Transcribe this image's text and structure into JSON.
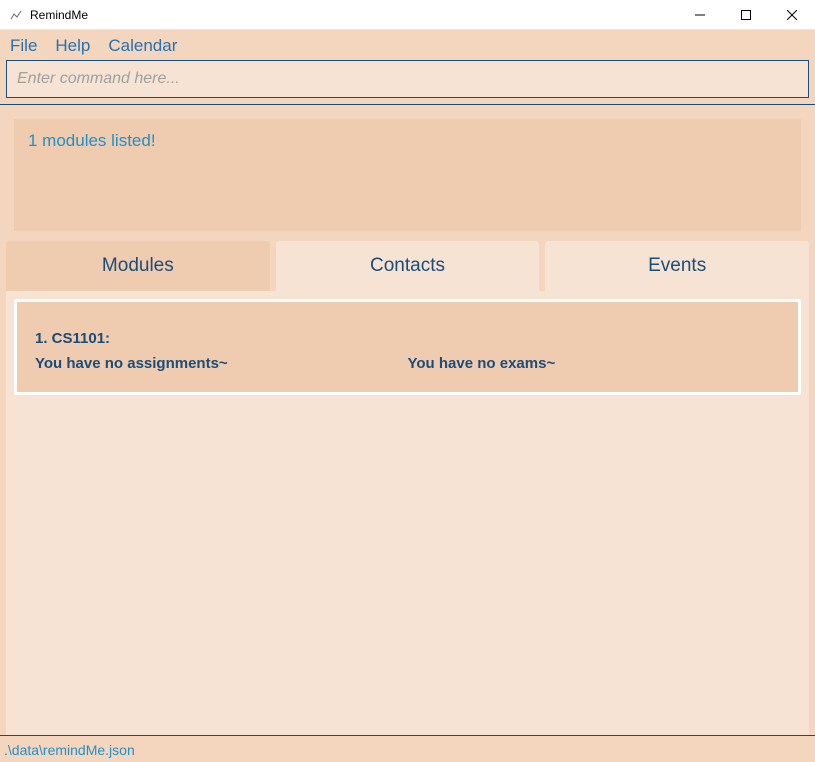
{
  "window": {
    "title": "RemindMe",
    "minimize": "—",
    "maximize": "☐",
    "close": "✕"
  },
  "menubar": {
    "file": "File",
    "help": "Help",
    "calendar": "Calendar"
  },
  "command": {
    "placeholder": "Enter command here..."
  },
  "status": {
    "message": "1 modules listed!"
  },
  "tabs": {
    "modules": "Modules",
    "contacts": "Contacts",
    "events": "Events"
  },
  "modules": [
    {
      "title": "1. CS1101:",
      "assignments": "You have no assignments~",
      "exams": "You have no exams~"
    }
  ],
  "footer": {
    "path": ".\\data\\remindMe.json"
  }
}
